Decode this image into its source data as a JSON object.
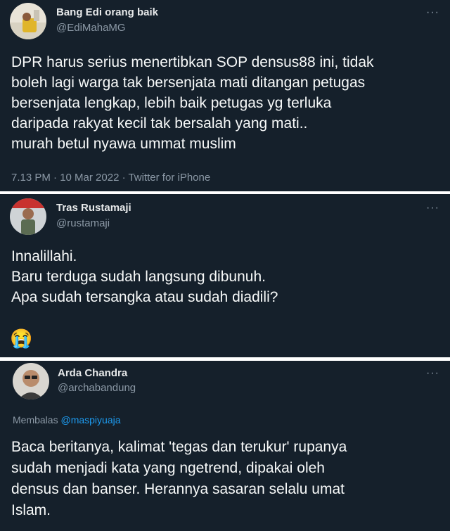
{
  "tweets": [
    {
      "author_name": "Bang Edi orang baik",
      "handle": "@EdiMahaMG",
      "more_icon": "more-horizontal-icon",
      "lines": [
        "DPR harus serius menertibkan SOP densus88 ini, tidak",
        "boleh lagi warga tak bersenjata mati ditangan petugas",
        "bersenjata lengkap, lebih baik petugas yg terluka",
        "daripada rakyat kecil tak bersalah yang mati..",
        "murah betul nyawa ummat muslim"
      ],
      "timestamp": "7.13 PM · 10 Mar 2022 · Twitter for iPhone"
    },
    {
      "author_name": "Tras Rustamaji",
      "handle": "@rustamaji",
      "more_icon": "more-horizontal-icon",
      "lines": [
        "Innalillahi.",
        "Baru terduga sudah langsung dibunuh.",
        "Apa sudah tersangka atau sudah diadili?"
      ],
      "emoji": "😭"
    },
    {
      "author_name": "Arda Chandra",
      "handle": "@archabandung",
      "more_icon": "more-horizontal-icon",
      "reply_prefix": "Membalas",
      "reply_to": "@maspiyuaja",
      "lines": [
        "Baca beritanya, kalimat 'tegas dan terukur' rupanya",
        "sudah menjadi kata yang ngetrend, dipakai oleh",
        "densus dan banser. Herannya sasaran selalu umat",
        "Islam."
      ]
    }
  ],
  "colors": {
    "background": "#15202b",
    "separator": "#ffffff",
    "text": "#f7f9f9",
    "secondary": "#8b98a5",
    "link": "#1d9bf0"
  }
}
